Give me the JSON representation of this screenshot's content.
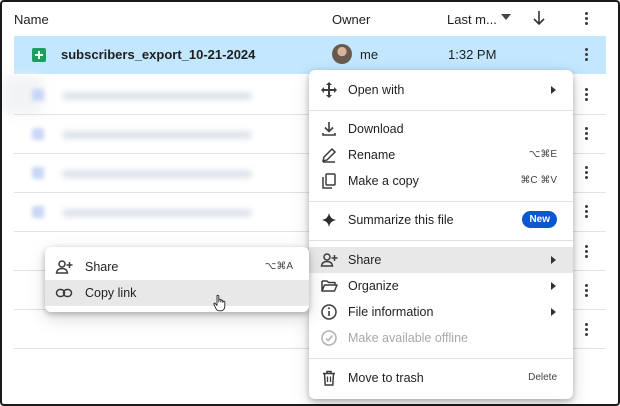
{
  "header": {
    "name_label": "Name",
    "owner_label": "Owner",
    "last_modified_label": "Last m..."
  },
  "selected_file": {
    "name": "subscribers_export_10-21-2024",
    "owner": "me",
    "time": "1:32 PM",
    "icon": "google-sheets-icon"
  },
  "context_menu": {
    "items": [
      {
        "label": "Open with",
        "icon": "move-arrows-icon",
        "submenu": true
      },
      {
        "label": "Download",
        "icon": "download-icon"
      },
      {
        "label": "Rename",
        "icon": "pencil-icon",
        "shortcut": "⌥⌘E"
      },
      {
        "label": "Make a copy",
        "icon": "copy-icon",
        "shortcut": "⌘C ⌘V"
      },
      {
        "label": "Summarize this file",
        "icon": "sparkle-icon",
        "badge": "New"
      },
      {
        "label": "Share",
        "icon": "person-add-icon",
        "submenu": true,
        "highlighted": true
      },
      {
        "label": "Organize",
        "icon": "folder-open-icon",
        "submenu": true
      },
      {
        "label": "File information",
        "icon": "info-icon",
        "submenu": true
      },
      {
        "label": "Make available offline",
        "icon": "offline-icon",
        "disabled": true
      },
      {
        "label": "Move to trash",
        "icon": "trash-icon",
        "shortcut": "Delete"
      }
    ]
  },
  "share_submenu": {
    "items": [
      {
        "label": "Share",
        "icon": "person-add-icon",
        "shortcut": "⌥⌘A"
      },
      {
        "label": "Copy link",
        "icon": "link-icon",
        "highlighted": true
      }
    ]
  },
  "colors": {
    "selection": "#c2e7ff",
    "sheets_green": "#18a05e",
    "badge_blue": "#0b57d0"
  }
}
